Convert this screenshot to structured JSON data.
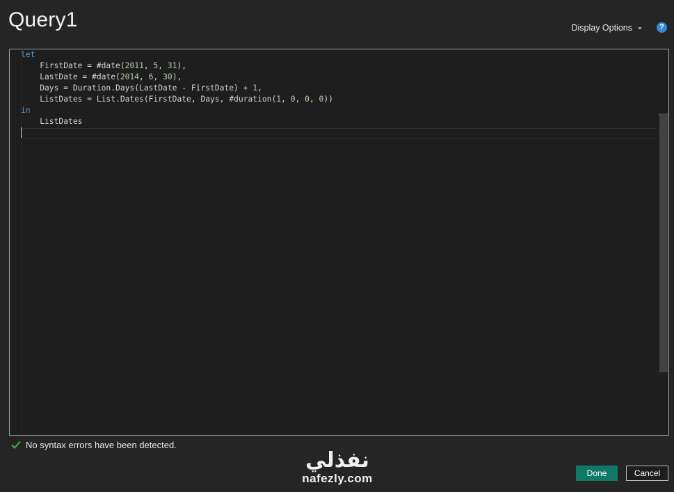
{
  "window": {
    "title": "Query1",
    "display_options_label": "Display Options",
    "help_label": "?"
  },
  "editor": {
    "lines": [
      [
        {
          "t": "let",
          "c": "kw"
        }
      ],
      [
        {
          "t": "    FirstDate = #date(",
          "c": ""
        },
        {
          "t": "2011",
          "c": "num"
        },
        {
          "t": ", ",
          "c": ""
        },
        {
          "t": "5",
          "c": "num"
        },
        {
          "t": ", ",
          "c": ""
        },
        {
          "t": "31",
          "c": "num"
        },
        {
          "t": "),",
          "c": ""
        }
      ],
      [
        {
          "t": "    LastDate = #date(",
          "c": ""
        },
        {
          "t": "2014",
          "c": "num"
        },
        {
          "t": ", ",
          "c": ""
        },
        {
          "t": "6",
          "c": "num"
        },
        {
          "t": ", ",
          "c": ""
        },
        {
          "t": "30",
          "c": "num"
        },
        {
          "t": "),",
          "c": ""
        }
      ],
      [
        {
          "t": "    Days = Duration.Days(LastDate - FirstDate) + ",
          "c": ""
        },
        {
          "t": "1",
          "c": "num"
        },
        {
          "t": ",",
          "c": ""
        }
      ],
      [
        {
          "t": "    ListDates = List.Dates(FirstDate, Days, #duration(",
          "c": ""
        },
        {
          "t": "1",
          "c": "num"
        },
        {
          "t": ", ",
          "c": ""
        },
        {
          "t": "0",
          "c": "num"
        },
        {
          "t": ", ",
          "c": ""
        },
        {
          "t": "0",
          "c": "num"
        },
        {
          "t": ", ",
          "c": ""
        },
        {
          "t": "0",
          "c": "num"
        },
        {
          "t": "))",
          "c": ""
        }
      ],
      [
        {
          "t": "in",
          "c": "kw"
        }
      ],
      [
        {
          "t": "    ListDates",
          "c": ""
        }
      ],
      [
        {
          "t": "",
          "c": ""
        }
      ]
    ]
  },
  "status": {
    "message": "No syntax errors have been detected."
  },
  "watermark": {
    "arabic": "نفذلي",
    "latin": "nafezly.com"
  },
  "buttons": {
    "done": "Done",
    "cancel": "Cancel"
  },
  "colors": {
    "accent": "#117865",
    "keyword": "#569cd6",
    "number": "#b5cea8",
    "check": "#4caf50"
  }
}
